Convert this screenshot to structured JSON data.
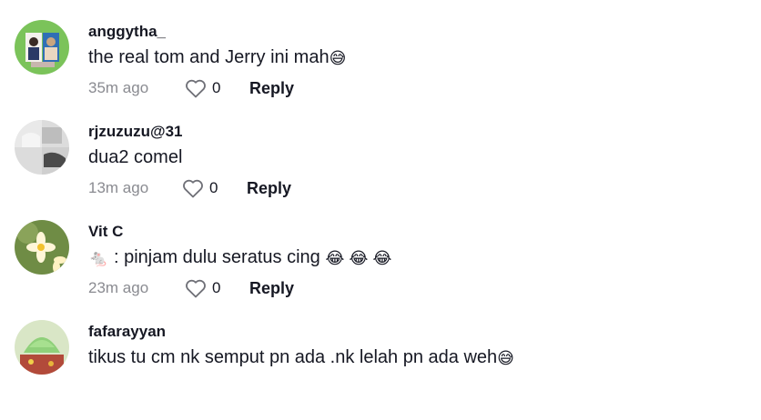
{
  "comments": [
    {
      "username": "anggytha_",
      "text": "the real tom and Jerry ini mah",
      "emoji": "😅",
      "time": "35m ago",
      "likes": "0",
      "reply_label": "Reply"
    },
    {
      "username": "rjzuzuzu@31",
      "text": "dua2 comel",
      "time": "13m ago",
      "likes": "0",
      "reply_label": "Reply"
    },
    {
      "username": "Vit C",
      "text_prefix_emoji": "🐁",
      "text": " : pinjam dulu seratus cing ",
      "emoji": "😂 😂 😂",
      "time": "23m ago",
      "likes": "0",
      "reply_label": "Reply"
    },
    {
      "username": "fafarayyan",
      "text": "tikus tu cm nk semput pn ada .nk lelah pn ada weh",
      "emoji": "😅"
    }
  ]
}
